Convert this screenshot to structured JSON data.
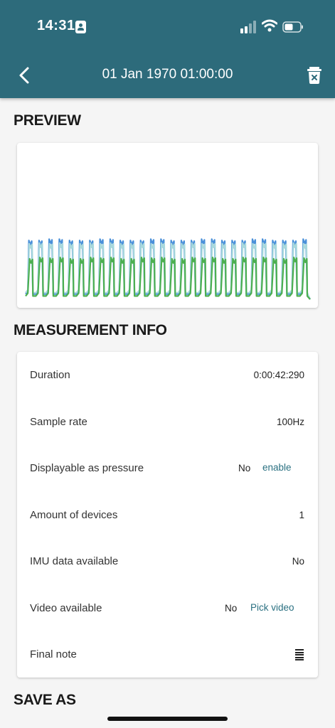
{
  "status_bar": {
    "time": "14:31"
  },
  "header": {
    "title": "01 Jan 1970 01:00:00",
    "back_icon": "chevron-left-icon",
    "delete_icon": "trash-icon"
  },
  "preview": {
    "section_title": "PREVIEW"
  },
  "chart_data": {
    "type": "line",
    "title": "",
    "xlabel": "",
    "ylabel": "",
    "grid": false,
    "legend": "none",
    "peaks": 28,
    "series": [
      {
        "color": "#4a90d9",
        "values": [
          0.08,
          0.9,
          0.08,
          0.9,
          0.08,
          0.92,
          0.08,
          0.92,
          0.08,
          0.9
        ]
      },
      {
        "color": "#a8d8dc",
        "values": [
          0.1,
          0.85,
          0.1,
          0.86,
          0.1,
          0.85,
          0.1,
          0.86,
          0.1,
          0.85
        ]
      },
      {
        "color": "#4caf50",
        "values": [
          0.05,
          0.62,
          0.05,
          0.64,
          0.05,
          0.63,
          0.05,
          0.64,
          0.05,
          0.62
        ]
      }
    ]
  },
  "info": {
    "section_title": "MEASUREMENT INFO",
    "rows": [
      {
        "label": "Duration",
        "value": "0:00:42:290"
      },
      {
        "label": "Sample rate",
        "value": "100Hz"
      },
      {
        "label": "Displayable as pressure",
        "status": "No",
        "action": "enable"
      },
      {
        "label": "Amount of devices",
        "value": "1"
      },
      {
        "label": "IMU data available",
        "value": "No"
      },
      {
        "label": "Video available",
        "status": "No",
        "action": "Pick video"
      },
      {
        "label": "Final note",
        "icon": "note-lines-icon"
      }
    ]
  },
  "save": {
    "section_title": "SAVE AS"
  }
}
